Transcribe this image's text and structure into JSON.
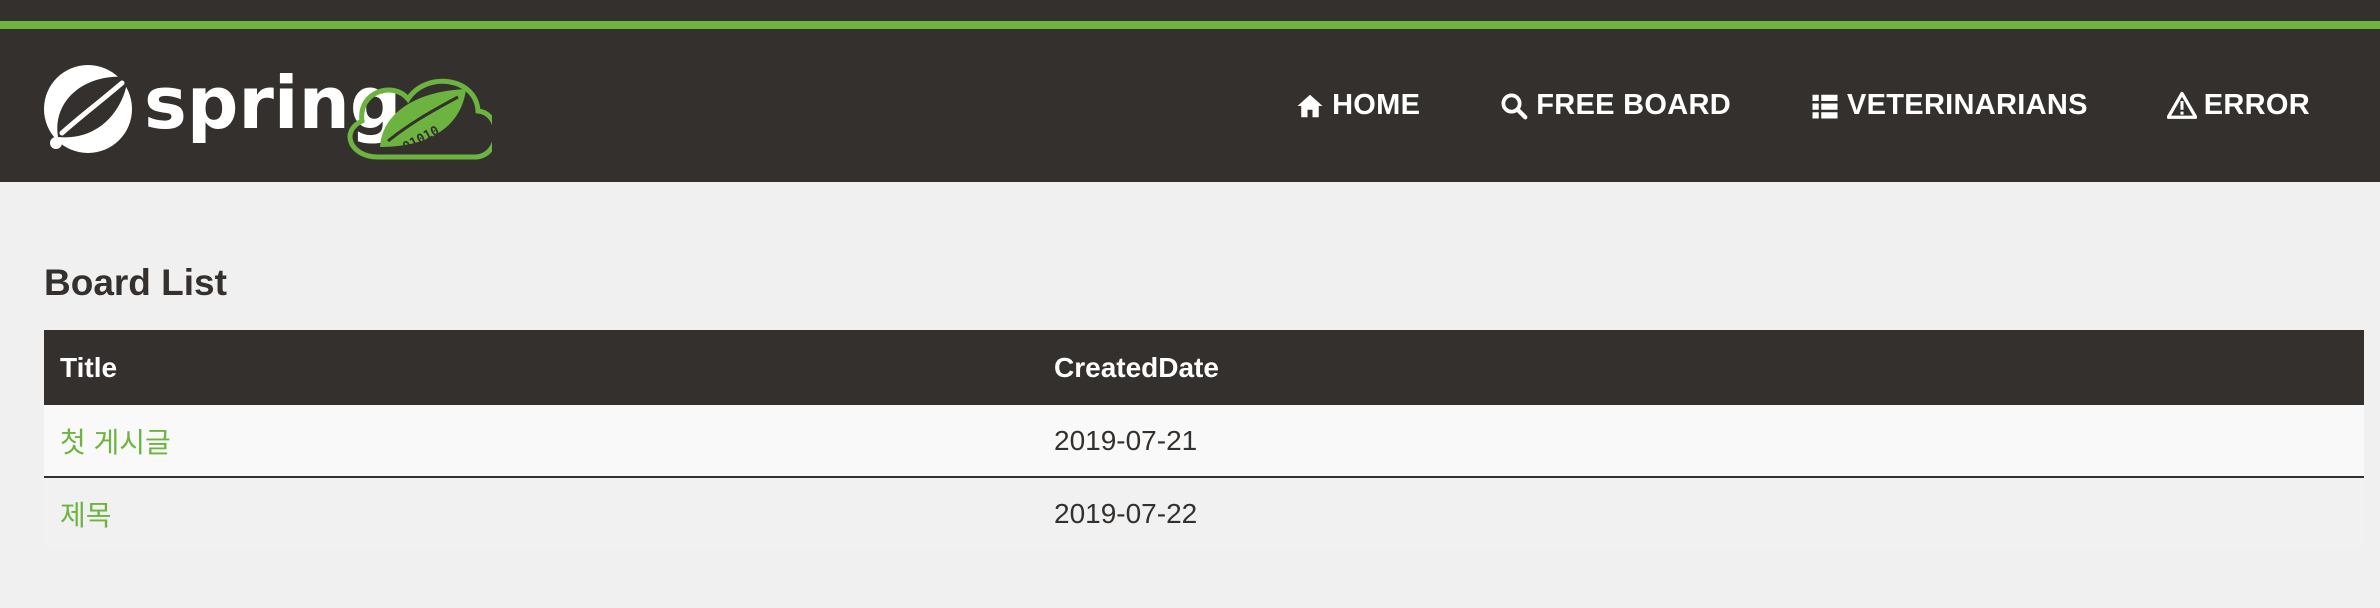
{
  "header": {
    "brand_icon": "spring-leaf-logo",
    "brand_text": "spring",
    "brand_badge_icon": "spring-cloud-leaf-icon",
    "brand_badge_text": "01010",
    "colors": {
      "bar": "#34302d",
      "accent": "#6db33f"
    },
    "nav": [
      {
        "label": "HOME",
        "icon": "home-icon"
      },
      {
        "label": "FREE BOARD",
        "icon": "search-icon"
      },
      {
        "label": "VETERINARIANS",
        "icon": "list-icon"
      },
      {
        "label": "ERROR",
        "icon": "warning-icon"
      }
    ]
  },
  "main": {
    "title": "Board List",
    "table": {
      "columns": [
        "Title",
        "CreatedDate"
      ],
      "rows": [
        {
          "title": "첫 게시글",
          "created": "2019-07-21"
        },
        {
          "title": "제목",
          "created": "2019-07-22"
        }
      ]
    }
  }
}
